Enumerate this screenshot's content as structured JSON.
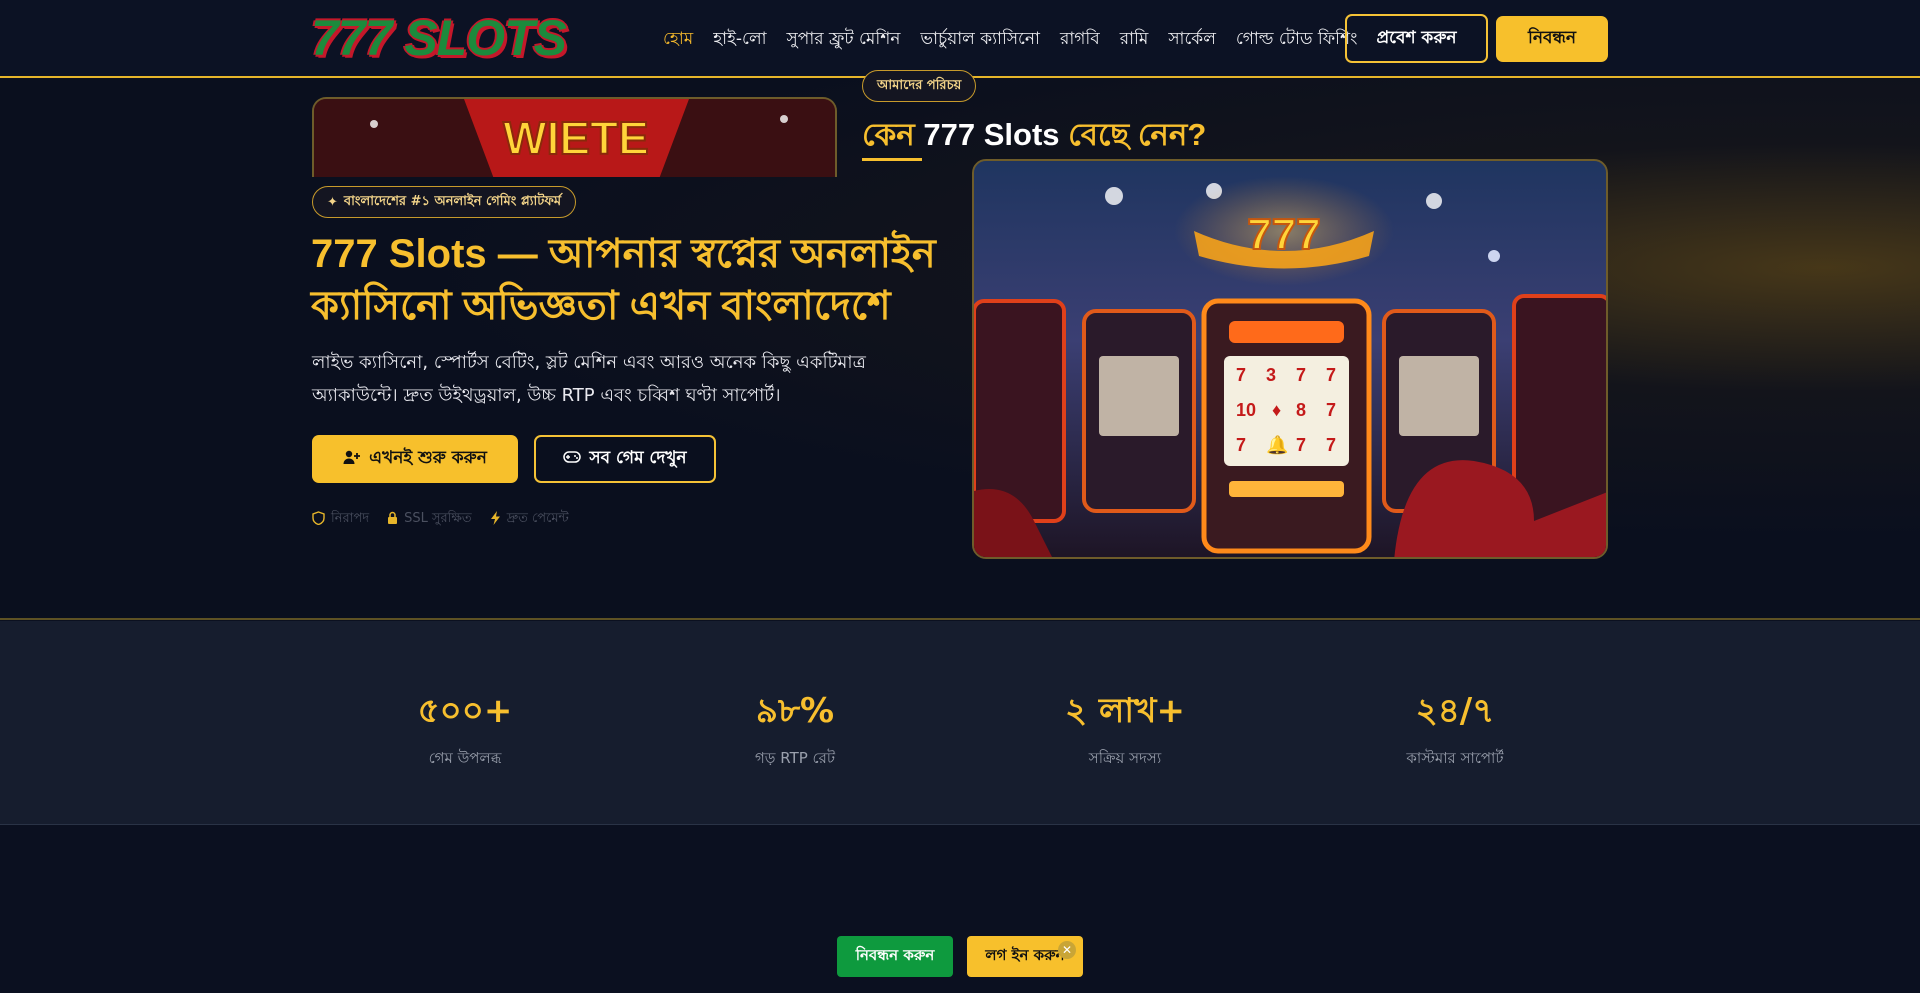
{
  "header": {
    "logo": "777 SLOTS",
    "nav": [
      "হোম",
      "হাই-লো",
      "সুপার ফ্রুট মেশিন",
      "ভার্চুয়াল ক্যাসিনো",
      "রাগবি",
      "রামি",
      "সার্কেল",
      "গোল্ড টোড ফিশিং"
    ],
    "active_nav": "হোম",
    "login_label": "প্রবেশ করুন",
    "register_label": "নিবন্ধন"
  },
  "hero": {
    "badge": "বাংলাদেশের #১ অনলাইন গেমিং প্ল্যাটফর্ম",
    "title": "777 Slots — আপনার স্বপ্নের অনলাইন ক্যাসিনো অভিজ্ঞতা এখন বাংলাদেশে",
    "description": "লাইভ ক্যাসিনো, স্পোর্টস বেটিং, স্লট মেশিন এবং আরও অনেক কিছু একটিমাত্র অ্যাকাউন্টে। দ্রুত উইথড্রয়াল, উচ্চ RTP এবং চব্বিশ ঘণ্টা সাপোর্ট।",
    "start_label": "এখনই শুরু করুন",
    "all_games_label": "সব গেম দেখুন",
    "trust": [
      "নিরাপদ",
      "SSL সুরক্ষিত",
      "দ্রুত পেমেন্ট"
    ],
    "image_sign": "777"
  },
  "stats": [
    {
      "value": "৫০০+",
      "label": "গেম উপলব্ধ"
    },
    {
      "value": "৯৮%",
      "label": "গড় RTP রেট"
    },
    {
      "value": "২ লাখ+",
      "label": "সক্রিয় সদস্য"
    },
    {
      "value": "২৪/৭",
      "label": "কাস্টমার সাপোর্ট"
    }
  ],
  "about": {
    "badge": "আমাদের পরিচয়",
    "title_prefix": "কেন ",
    "title_brand": "777 Slots",
    "title_suffix": " বেছে নেন?",
    "image_sign": "WIETE"
  },
  "floating": {
    "register_label": "নিবন্ধন করুন",
    "login_label": "লগ ইন করুন",
    "close_glyph": "✕"
  },
  "colors": {
    "accent": "#f7c02c",
    "background": "#0b1020",
    "register_green": "#0e9a3e"
  }
}
